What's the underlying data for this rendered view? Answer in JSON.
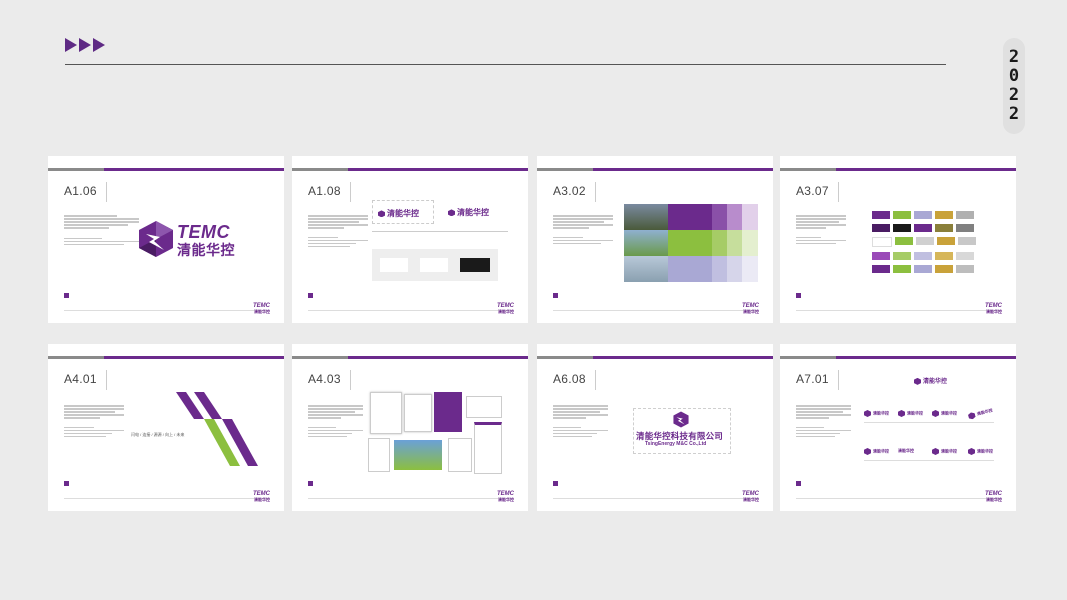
{
  "header": {
    "year_digits": [
      "2",
      "0",
      "2",
      "2"
    ]
  },
  "logo": {
    "en": "TEMC",
    "cn": "清能华控"
  },
  "company": {
    "cn": "清能华控科技有限公司",
    "en": "TsingEnergy M&C Co.,Ltd"
  },
  "cards": [
    {
      "code": "A1.06"
    },
    {
      "code": "A1.08"
    },
    {
      "code": "A3.02"
    },
    {
      "code": "A3.07"
    },
    {
      "code": "A4.01",
      "tagline": "闪电 / 连接 / 源源 / 向上 / 未来"
    },
    {
      "code": "A4.03"
    },
    {
      "code": "A6.08"
    },
    {
      "code": "A7.01"
    }
  ],
  "colors": {
    "brand_purple": "#6b2a8c",
    "brand_green": "#8cbf3f",
    "gray_bar": "#8a8a8a"
  }
}
